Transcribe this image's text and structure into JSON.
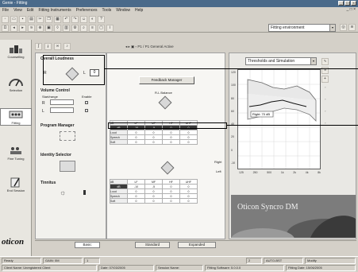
{
  "window": {
    "title": "Genie - Fitting"
  },
  "menu": [
    "File",
    "View",
    "Edit",
    "Fitting Instruments",
    "Preferences",
    "Tools",
    "Window",
    "Help"
  ],
  "toolbar": {
    "combo_value": "Fitting environment"
  },
  "sidebar": {
    "items": [
      {
        "label": "Counselling"
      },
      {
        "label": "Selection"
      },
      {
        "label": "Fitting"
      },
      {
        "label": "Fine Tuning"
      },
      {
        "label": "End Session"
      }
    ],
    "logo": "oticon"
  },
  "left_panel": {
    "overall_loudness": {
      "title": "Overall Loudness",
      "side_left": "R",
      "side_right": "L",
      "value": "0"
    },
    "volume_control": {
      "title": "Volume Control",
      "col1": "Start/range",
      "col2": "Enable",
      "row_r": "R",
      "row_l": "L"
    },
    "program_manager": {
      "title": "Program Manager"
    },
    "identity_selector": {
      "title": "Identity Selector"
    },
    "tinnitus": {
      "title": "Tinnitus"
    }
  },
  "middle_panel": {
    "button": "Feedback Manager",
    "balance_label": "R-L Balance",
    "right_label": "Right",
    "left_label": "Left",
    "table_top": {
      "headers": [
        "dB",
        "LF",
        "MF",
        "HF",
        "UHF"
      ],
      "rows": [
        [
          "dB",
          "-10",
          "-5",
          "0",
          "0"
        ],
        [
          "Loud",
          "0",
          "0",
          "0",
          "0"
        ],
        [
          "Speech",
          "0",
          "0",
          "0",
          "0"
        ],
        [
          "Soft",
          "0",
          "0",
          "0",
          "0"
        ]
      ]
    },
    "table_bottom": {
      "headers": [
        "dB",
        "LF",
        "MF",
        "HF",
        "UHF"
      ],
      "rows": [
        [
          "dB",
          "-10",
          "-5",
          "0",
          "0"
        ],
        [
          "Loud",
          "0",
          "0",
          "0",
          "0"
        ],
        [
          "Speech",
          "0",
          "0",
          "0",
          "0"
        ],
        [
          "Soft",
          "0",
          "0",
          "0",
          "0"
        ]
      ]
    }
  },
  "right_panel": {
    "combo": "Thresholds and Simulation",
    "graph_yticks": [
      "120",
      "100",
      "80",
      "60",
      "40",
      "20",
      "0",
      "-10"
    ],
    "graph_xticks": [
      "125",
      "250",
      "500",
      "1k",
      "2k",
      "4k",
      "8k"
    ],
    "legend": "Right: 70 dB",
    "banner_text": "Oticon Syncro DM"
  },
  "bottom_tabs": [
    "Basic",
    "Standard",
    "Expanded"
  ],
  "status": [
    "Ready",
    "GAIN: 0M",
    "1",
    "2",
    "AUTO-BST",
    "Modify"
  ],
  "status2": [
    "Client Name: Unregistered Client",
    "Date: 07/03/2005",
    "Session Name: ",
    "Fitting Software: 5.0.0.0",
    "Fitting Date: 15/06/2005"
  ]
}
